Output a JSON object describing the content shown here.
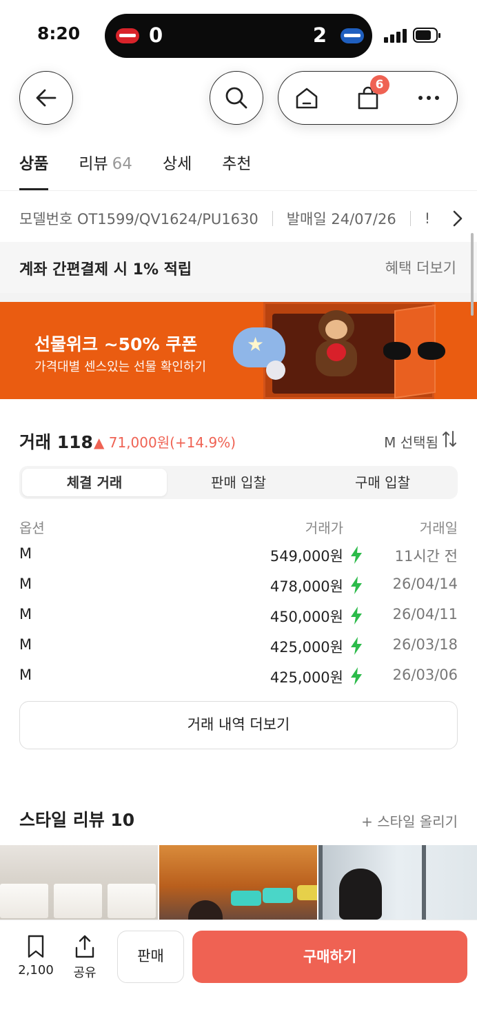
{
  "status_bar": {
    "time": "8:20",
    "score_left": "0",
    "score_right": "2",
    "icons": [
      "team-logo-left",
      "team-logo-right",
      "signal-icon",
      "battery-icon"
    ]
  },
  "nav": {
    "cart_badge": "6",
    "icons": [
      "back-arrow-icon",
      "search-icon",
      "home-icon",
      "shopping-bag-icon",
      "more-icon"
    ]
  },
  "tabs": [
    {
      "label": "상품",
      "count": "",
      "active": true
    },
    {
      "label": "리뷰",
      "count": "64",
      "active": false
    },
    {
      "label": "상세",
      "count": "",
      "active": false
    },
    {
      "label": "추천",
      "count": "",
      "active": false
    }
  ],
  "info": {
    "model": "모델번호 OT1599/QV1624/PU1630",
    "release": "발매일 24/07/26",
    "clipped_text": "!"
  },
  "benefit": {
    "text": "계좌 간편결제 시 1% 적립",
    "link": "혜택 더보기"
  },
  "banner": {
    "title": "선물위크 ~50% 쿠폰",
    "subtitle": "가격대별 센스있는 선물 확인하기",
    "bg_color": "#ea5c11"
  },
  "trade": {
    "title": "거래 118",
    "change": "▲ 71,000원(+14.9%)",
    "size_selected": "M 선택됨",
    "segments": [
      "체결 거래",
      "판매 입찰",
      "구매 입찰"
    ],
    "active_segment": 0,
    "columns": [
      "옵션",
      "거래가",
      "거래일"
    ],
    "rows": [
      {
        "option": "M",
        "price": "549,000원",
        "date": "11시간 전"
      },
      {
        "option": "M",
        "price": "478,000원",
        "date": "26/04/14"
      },
      {
        "option": "M",
        "price": "450,000원",
        "date": "26/04/11"
      },
      {
        "option": "M",
        "price": "425,000원",
        "date": "26/03/18"
      },
      {
        "option": "M",
        "price": "425,000원",
        "date": "26/03/06"
      }
    ],
    "more_label": "거래 내역 더보기",
    "accent_color": "#ef6253",
    "bolt_color": "#2cbb4a"
  },
  "style_review": {
    "title": "스타일 리뷰 10",
    "add_label": "+ 스타일 올리기"
  },
  "bottom_bar": {
    "save_count": "2,100",
    "share_label": "공유",
    "sell_label": "판매",
    "buy_label": "구매하기",
    "buy_color": "#ef6253"
  }
}
